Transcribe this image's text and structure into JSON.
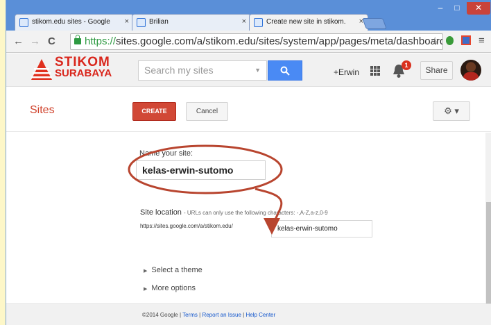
{
  "browser": {
    "tabs": [
      {
        "title": "stikom.edu sites - Google"
      },
      {
        "title": "Brilian"
      },
      {
        "title": "Create new site in stikom.",
        "active": true
      }
    ],
    "tab_close": "×",
    "window_controls": {
      "minimize": "‒",
      "maximize": "□",
      "close": "✕"
    },
    "nav": {
      "back": "←",
      "forward": "→",
      "reload": "C"
    },
    "url_scheme": "https://",
    "url_rest": "sites.google.com/a/stikom.edu/sites/system/app/pages/meta/dashboard/c",
    "star": "☆",
    "menu": "≡"
  },
  "header": {
    "logo_line1": "STIKOM",
    "logo_line2": "SURABAYA",
    "search_placeholder": "Search my sites",
    "search_dropdown": "▼",
    "search_button_icon": "search-icon",
    "user_name": "+Erwin",
    "notification_count": "1",
    "share_label": "Share"
  },
  "actionbar": {
    "title": "Sites",
    "create_label": "CREATE",
    "cancel_label": "Cancel",
    "settings_label": "⚙ ▾"
  },
  "form": {
    "name_label": "Name your site:",
    "site_name_value": "kelas-erwin-sutomo",
    "location_label": "Site location",
    "location_hint": "- URLs can only use the following characters: -,A-Z,a-z,0-9",
    "location_prefix": "https://sites.google.com/a/stikom.edu/",
    "location_value": "kelas-erwin-sutomo",
    "select_theme": "Select a theme",
    "more_options": "More options"
  },
  "footer": {
    "copyright": "©2014 Google",
    "sep": "|",
    "links": [
      "Terms",
      "Report an Issue",
      "Help Center"
    ]
  },
  "colors": {
    "accent_red": "#d14836",
    "annotation": "#b8452f",
    "search_blue": "#4a8af4",
    "chrome_blue": "#5a8fd8"
  }
}
